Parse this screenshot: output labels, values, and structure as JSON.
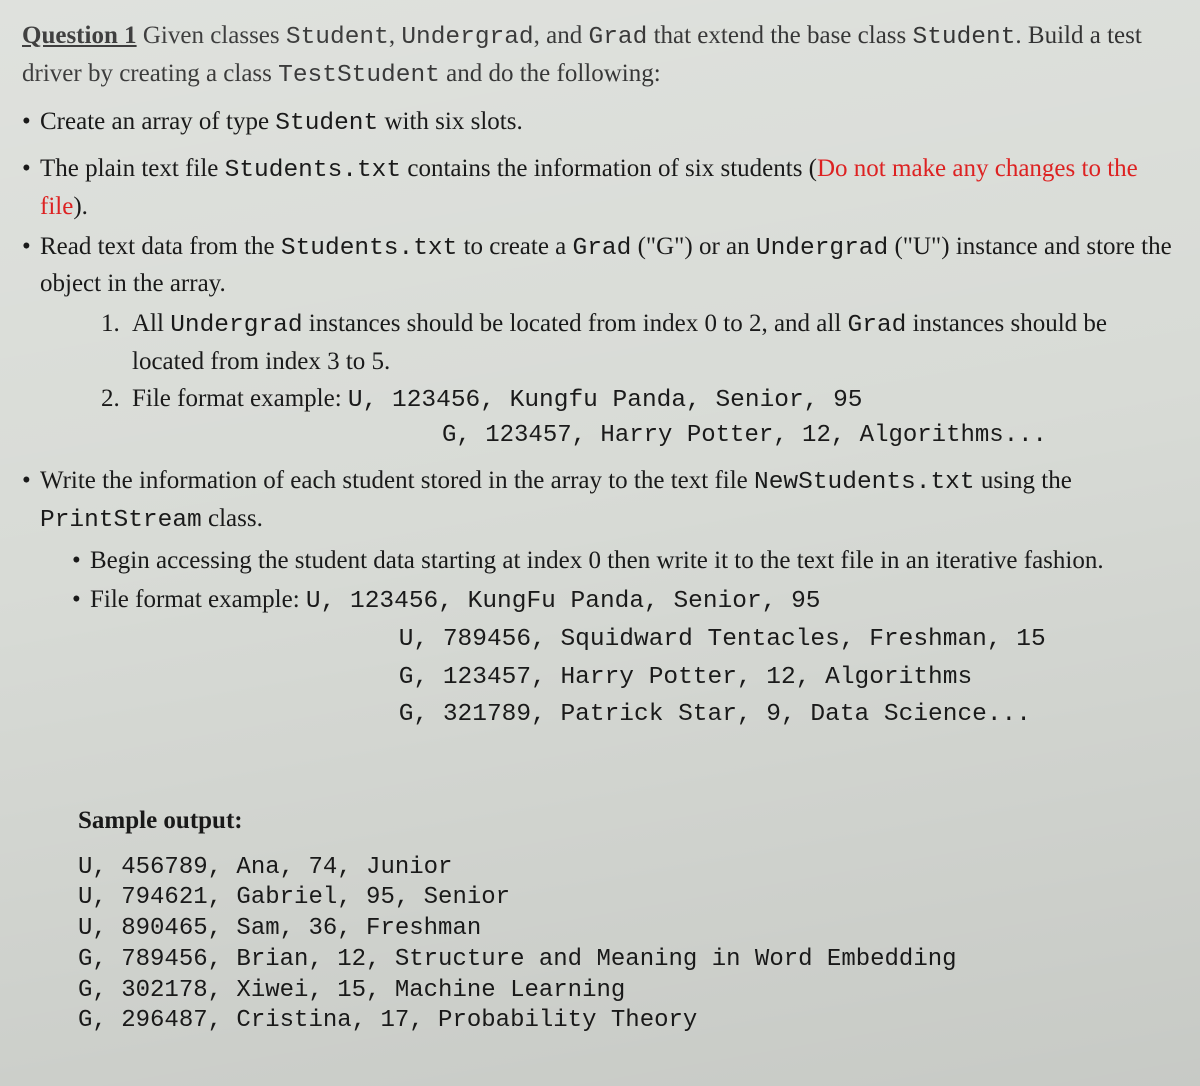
{
  "heading": {
    "title": "Question 1",
    "intro_a": " Given classes ",
    "code1": "Student",
    "intro_b": ", ",
    "code2": "Undergrad",
    "intro_c": ", and ",
    "code3": "Grad",
    "intro_d": " that extend the base class ",
    "code4": "Student",
    "intro_e": ". Build a test driver by creating a class ",
    "code5": "TestStudent",
    "intro_f": " and do the following:"
  },
  "bullets": {
    "b1_a": "Create an array of type ",
    "b1_code": "Student",
    "b1_b": " with six slots.",
    "b2_a": "The plain text file ",
    "b2_code": "Students.txt",
    "b2_b": " contains the information of six students (",
    "b2_warn": "Do not make any changes to the file",
    "b2_c": ").",
    "b3_a": "Read text data from the ",
    "b3_code1": "Students.txt",
    "b3_b": " to create a ",
    "b3_code2": "Grad",
    "b3_c": " (\"G\") or an ",
    "b3_code3": "Undergrad",
    "b3_d": " (\"U\") instance and store the object in the array."
  },
  "numbered": {
    "n1_a": "All ",
    "n1_code1": "Undergrad",
    "n1_b": " instances should be located from index 0 to 2, and all ",
    "n1_code2": "Grad",
    "n1_c": " instances should be located from index 3 to 5.",
    "n2_a": "File format example: ",
    "n2_code": "U, 123456, Kungfu Panda, Senior, 95",
    "n2_code_line2": "G, 123457, Harry Potter, 12, Algorithms..."
  },
  "b4": {
    "a": "Write the information of each student stored in the array to the text file ",
    "code": "NewStudents.txt",
    "b": " using the ",
    "code2": "PrintStream",
    "c": " class."
  },
  "inner": {
    "i1": "Begin accessing the student data starting at index 0 then write it to the text file in an iterative fashion.",
    "i2_a": "File format example: ",
    "i2_code": "U, 123456, KungFu Panda, Senior, 95\n                     U, 789456, Squidward Tentacles, Freshman, 15\n                     G, 123457, Harry Potter, 12, Algorithms\n                     G, 321789, Patrick Star, 9, Data Science..."
  },
  "sample": {
    "heading": "Sample output:",
    "output": "U, 456789, Ana, 74, Junior\nU, 794621, Gabriel, 95, Senior\nU, 890465, Sam, 36, Freshman\nG, 789456, Brian, 12, Structure and Meaning in Word Embedding\nG, 302178, Xiwei, 15, Machine Learning\nG, 296487, Cristina, 17, Probability Theory"
  }
}
